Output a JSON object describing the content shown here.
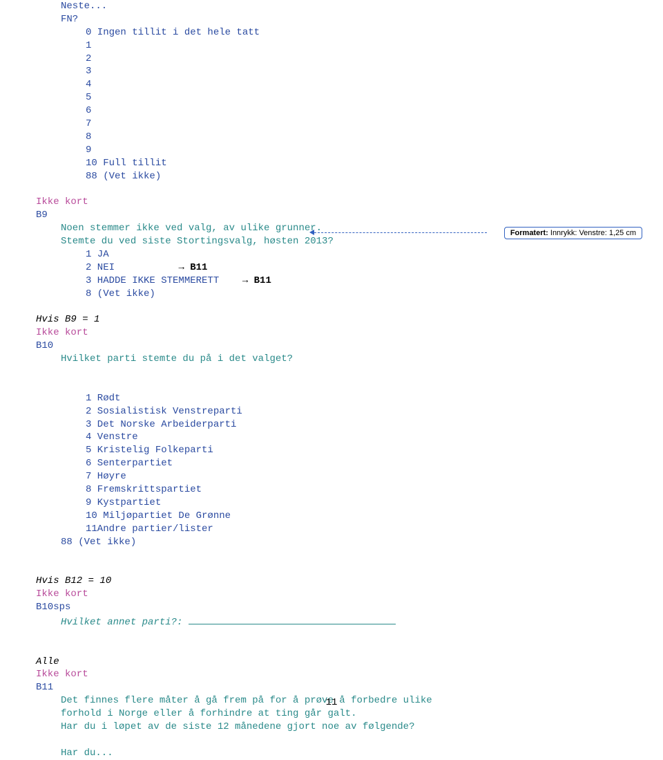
{
  "top": {
    "neste": "Neste...",
    "fn": "FN?",
    "scale0": "0 Ingen tillit i det hele tatt",
    "n1": "1",
    "n2": "2",
    "n3": "3",
    "n4": "4",
    "n5": "5",
    "n6": "6",
    "n7": "7",
    "n8": "8",
    "n9": "9",
    "scale10": "10 Full tillit",
    "vet": "88 (Vet ikke)"
  },
  "b9": {
    "ikkekort": "Ikke kort",
    "label": "B9",
    "q1": "Noen stemmer ikke ved valg, av ulike grunner.",
    "q2": "Stemte du ved siste Stortingsvalg, høsten 2013?",
    "opt1a": "1 JA",
    "opt2a": "2 NEI",
    "opt2b": "→ B11",
    "opt3a": "3 HADDE IKKE STEMMERETT",
    "opt3b": "→ B11",
    "opt4": "8 (Vet ikke)"
  },
  "b10": {
    "cond": "Hvis B9 = 1",
    "ikkekort": "Ikke kort",
    "label": "B10",
    "q": "Hvilket parti stemte du på i det valget?",
    "parties": {
      "p1": "1 Rødt",
      "p2": "2 Sosialistisk Venstreparti",
      "p3": "3 Det Norske Arbeiderparti",
      "p4": "4 Venstre",
      "p5": "5 Kristelig Folkeparti",
      "p6": "6 Senterpartiet",
      "p7": "7 Høyre",
      "p8": "8 Fremskrittspartiet",
      "p9": "9 Kystpartiet",
      "p10": "10 Miljøpartiet De Grønne",
      "p11": "11Andre partier/lister"
    },
    "vet": "88 (Vet ikke)"
  },
  "b10sps": {
    "cond": "Hvis B12 = 10",
    "ikkekort": "Ikke kort",
    "label": "B10sps",
    "q": "Hvilket annet parti?: "
  },
  "b11": {
    "alle": "Alle",
    "ikkekort": "Ikke kort",
    "label": "B11",
    "q1": "Det finnes flere måter å gå frem på for å prøve å forbedre ulike",
    "q2": "forhold i Norge eller å forhindre at ting går galt.",
    "q3": "Har du i løpet av de siste 12 månedene gjort noe av følgende?",
    "q4": "Har du..."
  },
  "comment": {
    "label": "Formatert:",
    "text": " Innrykk: Venstre:  1,25 cm"
  },
  "pagenum": "11"
}
